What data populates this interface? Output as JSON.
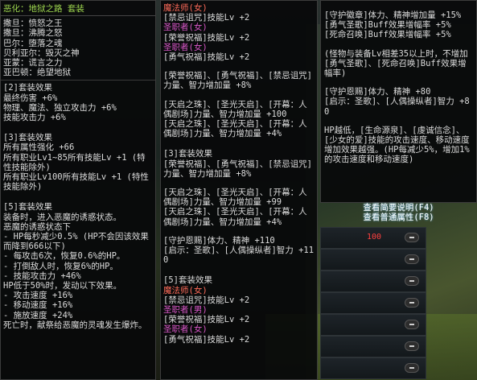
{
  "left": {
    "title": "恶化：地狱之路  套装",
    "set_items": [
      "撒旦：愤怒之王",
      "撒旦：沸腾之怒",
      "巴尔：堕落之魂",
      "贝利亚尔：毁灭之神",
      "亚蒙：谎言之力",
      "亚巴顿：绝望地狱"
    ],
    "set2_header": "[2]套装效果",
    "set2_lines": [
      "最终伤害 +6%",
      "物理、魔法、独立攻击力 +6%",
      "技能攻击力 +6%"
    ],
    "set3_header": "[3]套装效果",
    "set3_lines": [
      "所有属性强化 +66",
      "所有职业Lv1~85所有技能Lv +1 (特性技能除外)",
      "所有职业Lv100所有技能Lv +1 (特性技能除外)"
    ],
    "set5_header": "[5]套装效果",
    "set5_lines": [
      "装备时，进入恶魔的诱惑状态。",
      "恶魔的诱惑状态下",
      "- HP每秒减少0.5% (HP不会因该效果而降到666以下)",
      "- 每攻击6次，恢复0.6%的HP。",
      "- 打倒敌人时，恢复6%的HP。",
      "- 技能攻击力 +46%",
      "HP低于50%时，发动以下效果。",
      "- 攻击速度 +16%",
      "- 移动速度 +16%",
      "- 施放速度 +24%",
      "死亡时，献祭给恶魔的灵魂发生爆炸。"
    ]
  },
  "mid": {
    "top_job": "魔法师(女)",
    "top_lines": [
      "[禁忌诅咒]技能Lv +2"
    ],
    "sub1": "圣职者(女)",
    "sub1_lines": [
      "[荣誉祝福]技能Lv +2"
    ],
    "sub2": "圣职者(女)",
    "sub2_lines": [
      "[勇气祝福]技能Lv +2"
    ],
    "block1": [
      "[荣誉祝福]、[勇气祝福]、[禁忌诅咒]力量、智力增加量 +8%"
    ],
    "block2": [
      "[天启之珠]、[圣光天启]、[开幕：人偶剧场]力量、智力增加量 +100"
    ],
    "block3": [
      "[天启之珠]、[圣光天启]、[开幕：人偶剧场]力量、智力增加量 +4%"
    ],
    "set3_header": "[3]套装效果",
    "set3_lines": [
      "[荣誉祝福]、[勇气祝福]、[禁忌诅咒]力量、智力增加量 +8%"
    ],
    "block4": [
      "[天启之珠]、[圣光天启]、[开幕：人偶剧场]力量、智力增加量 +99"
    ],
    "block5": [
      "[天启之珠]、[圣光天启]、[开幕：人偶剧场]力量、智力增加量 +4%"
    ],
    "block6": [
      "[守护恩赐]体力、精神 +110",
      "[启示：圣歌]、[人偶操纵者]智力 +110"
    ],
    "set5_header": "[5]套装效果",
    "job2": "魔法师(女)",
    "job2_lines": [
      "[禁忌诅咒]技能Lv +2"
    ],
    "sub3": "圣职者(男)",
    "sub3_lines": [
      "[荣誉祝福]技能Lv +2"
    ],
    "sub4": "圣职者(女)",
    "sub4_lines": [
      "[勇气祝福]技能Lv +2"
    ]
  },
  "right": {
    "lines1": [
      "[守护徽章]体力、精神增加量 +15%",
      "[勇气圣歌]Buff效果增幅率 +5%",
      "[死命召唤]Buff效果增幅率 +5%"
    ],
    "lines2": [
      "(怪物与装备Lv相差35以上时，不增加[勇气圣歌]、[死命召唤]Buff效果增幅率)"
    ],
    "lines3": [
      "[守护恩赐]体力、精神 +80",
      "[启示：圣歌]、[人偶操纵者]智力 +80"
    ],
    "lines4": [
      "HP越低，[生命源泉]、[虔诚信念]、[少女的爱]技能的攻击速度、移动速度增加效果越强。(HP每减少5%，增加1%的攻击速度和移动速度)"
    ],
    "action1": "查看简要说明(F4)",
    "action2": "查看普通属性(F8)"
  },
  "slots": {
    "first_value": "100"
  }
}
